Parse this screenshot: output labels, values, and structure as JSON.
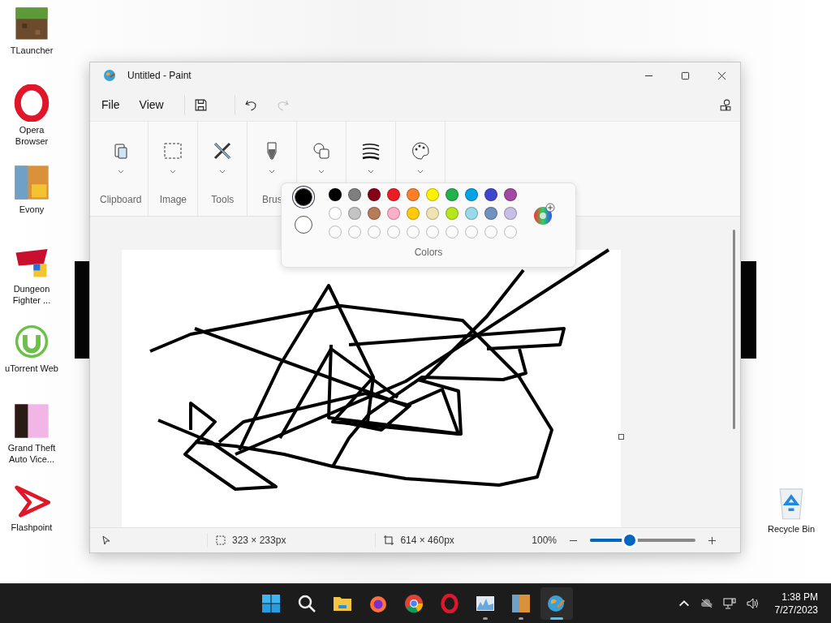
{
  "desktop": {
    "icons": [
      {
        "label": "TLauncher",
        "kind": "grass"
      },
      {
        "label": "Opera Browser",
        "kind": "opera"
      },
      {
        "label": "Evony",
        "kind": "game"
      },
      {
        "label": "Dungeon Fighter ...",
        "kind": "fighter"
      },
      {
        "label": "uTorrent Web",
        "kind": "utorrent"
      },
      {
        "label": "Grand Theft Auto Vice...",
        "kind": "poster"
      },
      {
        "label": "Flashpoint",
        "kind": "flashpoint"
      }
    ],
    "recycle_bin": {
      "label": "Recycle Bin"
    }
  },
  "window": {
    "title": "Untitled - Paint",
    "menu": [
      "File",
      "View"
    ],
    "toolbar": [
      {
        "kind": "save",
        "disabled": false
      },
      {
        "kind": "undo",
        "disabled": false
      },
      {
        "kind": "redo",
        "disabled": true
      }
    ],
    "ribbon": [
      {
        "kind": "clipboard",
        "label": "Clipboard"
      },
      {
        "kind": "image",
        "label": "Image"
      },
      {
        "kind": "tools",
        "label": "Tools"
      },
      {
        "kind": "brushes",
        "label": "Brus"
      },
      {
        "kind": "shapes"
      },
      {
        "kind": "size"
      },
      {
        "kind": "colors"
      }
    ],
    "colors_popup": {
      "title": "Colors",
      "current": [
        {
          "color": "#000000",
          "selected": true
        },
        {
          "color": "#ffffff",
          "selected": false
        }
      ],
      "palette": [
        [
          {
            "color": "#000000"
          },
          {
            "color": "#7f7f7f"
          },
          {
            "color": "#880015"
          },
          {
            "color": "#ed1c24"
          },
          {
            "color": "#ff7f27"
          },
          {
            "color": "#fff200"
          },
          {
            "color": "#22b14c"
          },
          {
            "color": "#00a2e8"
          },
          {
            "color": "#3f48cc"
          },
          {
            "color": "#a349a4"
          }
        ],
        [
          {
            "color": "#ffffff"
          },
          {
            "color": "#c3c3c3"
          },
          {
            "color": "#b97a57"
          },
          {
            "color": "#ffaec9"
          },
          {
            "color": "#ffc90e"
          },
          {
            "color": "#efe4b0"
          },
          {
            "color": "#b5e61d"
          },
          {
            "color": "#99d9ea"
          },
          {
            "color": "#7092be"
          },
          {
            "color": "#c8bfe7"
          }
        ]
      ]
    },
    "status_bar": {
      "selection": "323 × 233px",
      "canvas_size": "614 × 460px",
      "zoom": "100%",
      "zoom_level": {
        "level": 0.38
      }
    }
  },
  "taskbar": {
    "apps": [
      {
        "kind": "start",
        "running": false,
        "active": false
      },
      {
        "kind": "search",
        "running": false,
        "active": false
      },
      {
        "kind": "folder",
        "running": false,
        "active": false
      },
      {
        "kind": "firefox",
        "running": false,
        "active": false
      },
      {
        "kind": "chrome",
        "running": false,
        "active": false
      },
      {
        "kind": "opera",
        "running": false,
        "active": false
      },
      {
        "kind": "monitor",
        "running": true,
        "active": false
      },
      {
        "kind": "game",
        "running": true,
        "active": false
      },
      {
        "kind": "paint",
        "running": true,
        "active": true
      }
    ],
    "time": "1:38 PM",
    "date": "7/27/2023"
  }
}
